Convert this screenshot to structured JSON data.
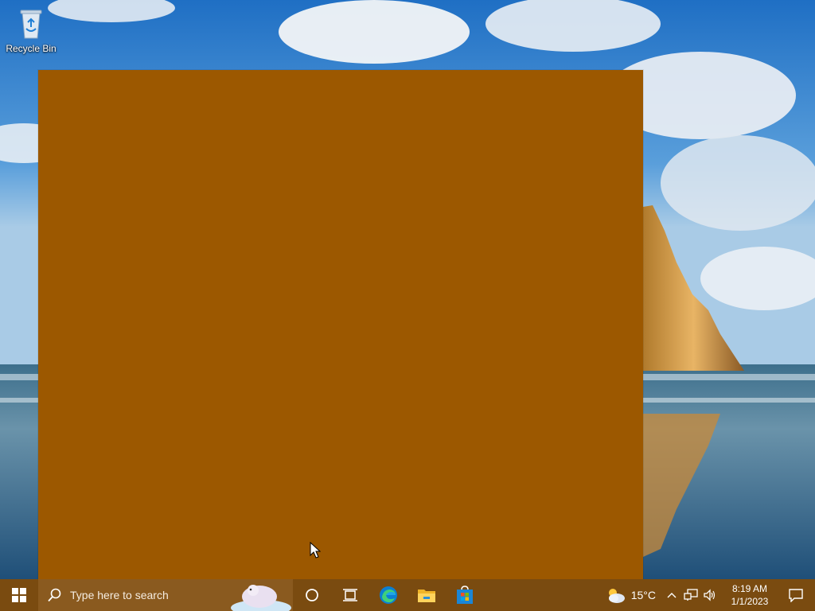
{
  "desktop": {
    "icons": [
      {
        "label": "Recycle Bin",
        "icon": "recycle-bin-icon"
      }
    ]
  },
  "app_window": {
    "color": "#9c5800"
  },
  "taskbar": {
    "search_placeholder": "Type here to search",
    "pinned": [
      {
        "name": "cortana",
        "icon": "cortana-icon"
      },
      {
        "name": "task-view",
        "icon": "task-view-icon"
      },
      {
        "name": "edge",
        "icon": "edge-icon"
      },
      {
        "name": "file-explorer",
        "icon": "file-explorer-icon"
      },
      {
        "name": "microsoft-store",
        "icon": "store-icon"
      }
    ],
    "weather": {
      "temperature": "15°C",
      "icon": "partly-cloudy-icon"
    },
    "clock": {
      "time": "8:19 AM",
      "date": "1/1/2023"
    },
    "colors": {
      "taskbar": "#7a4b10",
      "search": "#8a5a1f"
    }
  }
}
